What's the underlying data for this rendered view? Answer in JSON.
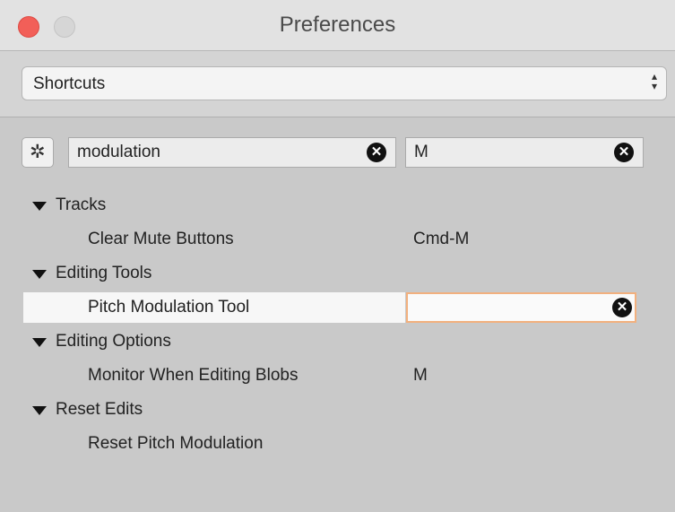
{
  "window": {
    "title": "Preferences"
  },
  "category_select": {
    "value": "Shortcuts"
  },
  "filter": {
    "command_value": "modulation",
    "key_value": "M"
  },
  "groups": [
    {
      "label": "Tracks",
      "items": [
        {
          "label": "Clear Mute Buttons",
          "shortcut": "Cmd-M"
        }
      ]
    },
    {
      "label": "Editing Tools",
      "items": [
        {
          "label": "Pitch Modulation Tool",
          "shortcut": ""
        }
      ]
    },
    {
      "label": "Editing Options",
      "items": [
        {
          "label": "Monitor When Editing Blobs",
          "shortcut": "M"
        }
      ]
    },
    {
      "label": "Reset Edits",
      "items": [
        {
          "label": "Reset Pitch Modulation",
          "shortcut": ""
        }
      ]
    }
  ]
}
